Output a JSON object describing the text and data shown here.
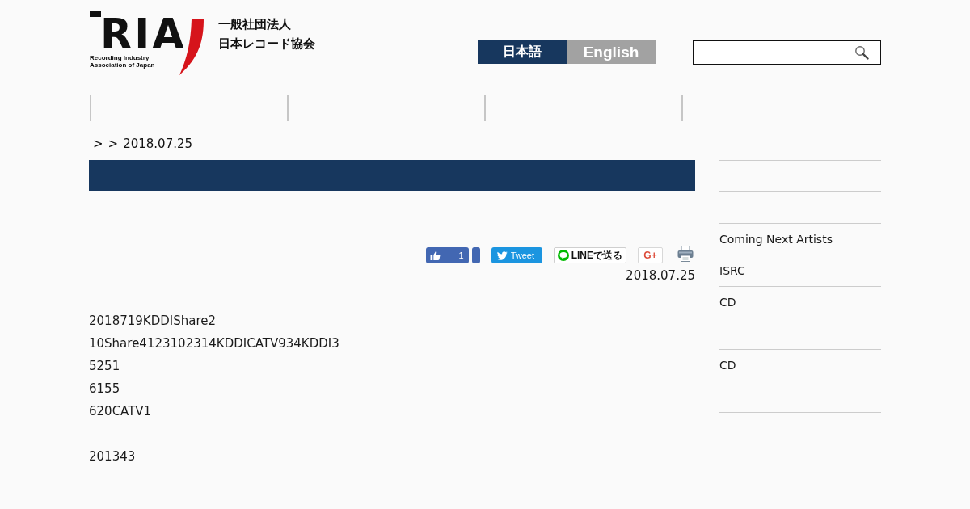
{
  "header": {
    "logo": {
      "wordmark": "RIA",
      "caption": "Recording Industry Association of Japan"
    },
    "org_name": [
      "一般社団法人",
      "日本レコード協会"
    ],
    "languages": [
      {
        "label": "日本語",
        "selected": true
      },
      {
        "label": "English",
        "selected": false
      }
    ]
  },
  "breadcrumb": [
    ">",
    ">",
    "2018.07.25"
  ],
  "article": {
    "share": [
      {
        "kind": "like",
        "count": "1"
      },
      {
        "kind": "tweet",
        "label": "Tweet"
      },
      {
        "kind": "line",
        "label": "LINEで送る"
      },
      {
        "kind": "gplus",
        "label": "G+"
      },
      {
        "kind": "print"
      }
    ],
    "date": "2018.07.25",
    "paragraphs": [
      [
        "2018719KDDIShare2",
        "10Share4123102314KDDICATV934KDDI3",
        "5251",
        "6155",
        "620CATV1"
      ],
      [
        "201343"
      ]
    ]
  },
  "sidebar": {
    "items": [
      {
        "kind": "blank"
      },
      {
        "kind": "blank"
      },
      {
        "kind": "link",
        "label": "Coming Next Artists"
      },
      {
        "kind": "link",
        "label": "ISRC"
      },
      {
        "kind": "link",
        "label": "CD"
      },
      {
        "kind": "blank"
      },
      {
        "kind": "link",
        "label": "CD"
      },
      {
        "kind": "blank"
      }
    ]
  }
}
